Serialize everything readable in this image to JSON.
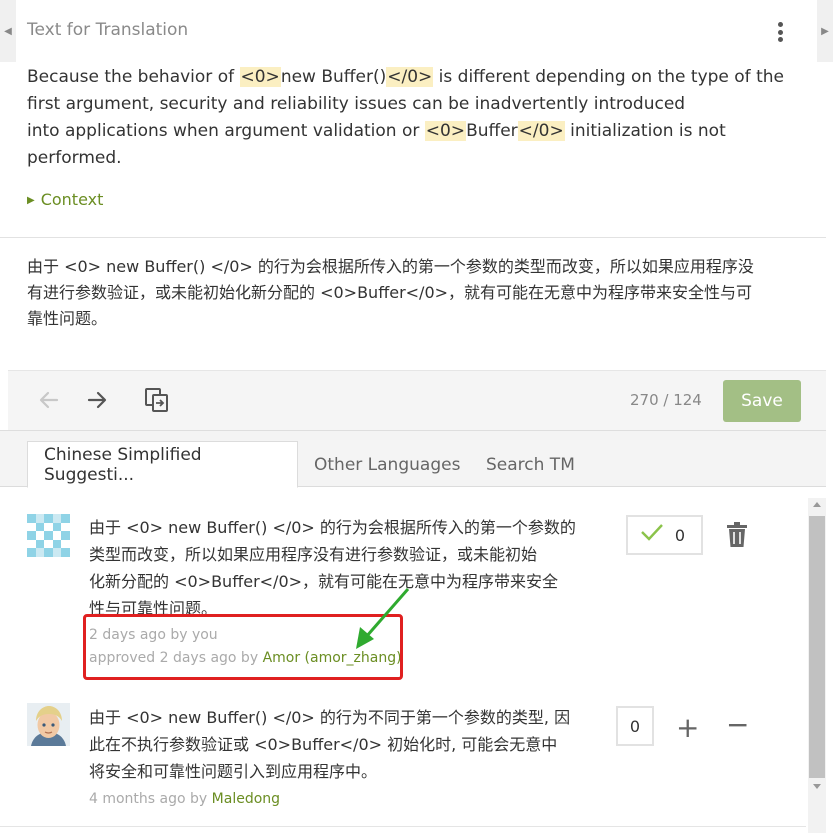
{
  "header": {
    "title": "Text for Translation",
    "more_icon": "kebab-menu-icon",
    "prev_icon": "caret-left-icon",
    "next_icon": "caret-right-icon"
  },
  "source": {
    "l1_a": "Because the behavior of ",
    "l1_tag_open": "<0>",
    "l1_b": "new Buffer()",
    "l1_tag_close": "</0>",
    "l1_c": " is different depending on the type of the",
    "l2": "first argument, security and reliability issues can be inadvertently introduced",
    "l3_a": "into applications when argument validation or ",
    "l3_tag_open": "<0>",
    "l3_b": "Buffer",
    "l3_tag_close": "</0>",
    "l3_c": " initialization is not",
    "l4": "performed."
  },
  "context": {
    "label": "Context"
  },
  "translation": {
    "lines": [
      "由于 <0> new Buffer() </0> 的行为会根据所传入的第一个参数的类型而改变，所以如果应用程序没",
      "有进行参数验证，或未能初始化新分配的 <0>Buffer</0>，就有可能在无意中为程序带来安全性与可",
      "靠性问题。"
    ]
  },
  "toolbar": {
    "count": "270 / 124",
    "save_label": "Save",
    "back_icon": "arrow-left-icon",
    "forward_icon": "arrow-right-icon",
    "copy_icon": "copy-source-icon"
  },
  "tabs": [
    {
      "label": "Chinese Simplified Suggesti..."
    },
    {
      "label": "Other Languages"
    },
    {
      "label": "Search TM"
    }
  ],
  "suggestions": [
    {
      "lines": [
        "由于 <0> new Buffer() </0> 的行为会根据所传入的第一个参数的",
        "类型而改变，所以如果应用程序没有进行参数验证，或未能初始",
        "化新分配的 <0>Buffer</0>，就有可能在无意中为程序带来安全",
        "性与可靠性问题。"
      ],
      "meta1": "2 days ago by you",
      "meta2_prefix": "approved 2 days ago by ",
      "meta2_link": "Amor (amor_zhang)",
      "votes": "0"
    },
    {
      "lines": [
        "由于 <0> new Buffer() </0> 的行为不同于第一个参数的类型, 因",
        "此在不执行参数验证或 <0>Buffer</0> 初始化时, 可能会无意中",
        "将安全和可靠性问题引入到应用程序中。"
      ],
      "meta_prefix": "4 months ago by ",
      "meta_link": "Maledong",
      "votes": "0"
    }
  ],
  "colors": {
    "accent_green": "#6b8e23",
    "save_button": "#a3bf85",
    "tag_highlight": "#fbefc2",
    "annotation_red": "#e02020",
    "annotation_arrow": "#2faa2f"
  }
}
